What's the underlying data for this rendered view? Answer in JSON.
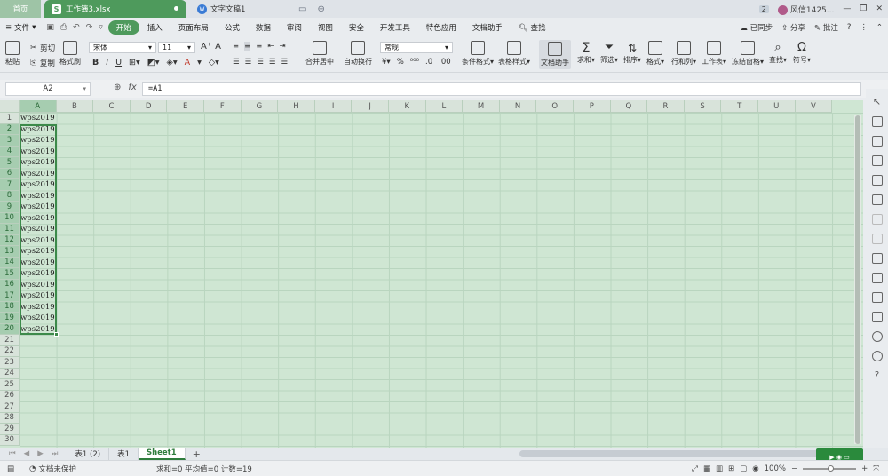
{
  "titlebar": {
    "home_tab": "首页",
    "active_file": "工作簿3.xlsx",
    "active_file_icon": "S",
    "doc_tab": "文字文稿1",
    "doc_icon": "W",
    "badge": "2",
    "username": "风信1425..."
  },
  "menubar": {
    "file_label": "文件",
    "items": [
      "开始",
      "插入",
      "页面布局",
      "公式",
      "数据",
      "审阅",
      "视图",
      "安全",
      "开发工具",
      "特色应用",
      "文档助手"
    ],
    "search": "查找",
    "sync": "已同步",
    "share": "分享",
    "comment": "批注"
  },
  "ribbon": {
    "paste": "粘贴",
    "cut": "剪切",
    "copy": "复制",
    "format_painter": "格式刷",
    "font_name": "宋体",
    "font_size": "11",
    "merge_center": "合并居中",
    "wrap_text": "自动换行",
    "number_format": "常规",
    "conditional_format": "条件格式",
    "table_style": "表格样式",
    "doc_assistant": "文档助手",
    "sum": "求和",
    "filter": "筛选",
    "sort": "排序",
    "format": "格式",
    "row_col": "行和列",
    "worksheet": "工作表",
    "freeze": "冻结窗格",
    "find": "查找",
    "symbol": "符号"
  },
  "formula": {
    "namebox": "A2",
    "fx": "fx",
    "content": "=A1"
  },
  "grid": {
    "columns": [
      "A",
      "B",
      "C",
      "D",
      "E",
      "F",
      "G",
      "H",
      "I",
      "J",
      "K",
      "L",
      "M",
      "N",
      "O",
      "P",
      "Q",
      "R",
      "S",
      "T",
      "U",
      "V"
    ],
    "rows": 30,
    "cells_A": [
      "wps2019",
      "wps2019",
      "wps2019",
      "wps2019",
      "wps2019",
      "wps2019",
      "wps2019",
      "wps2019",
      "wps2019",
      "wps2019",
      "wps2019",
      "wps2019",
      "wps2019",
      "wps2019",
      "wps2019",
      "wps2019",
      "wps2019",
      "wps2019",
      "wps2019",
      "wps2019"
    ]
  },
  "sheets": {
    "tabs": [
      "表1 (2)",
      "表1",
      "Sheet1"
    ],
    "active_index": 2
  },
  "status": {
    "protect": "文档未保护",
    "stats": "求和=0  平均值=0  计数=19",
    "zoom": "100%"
  },
  "colors": {
    "accent": "#4e9a5c",
    "grid_bg": "#cfe6d3",
    "selection": "#3c8a4a"
  }
}
